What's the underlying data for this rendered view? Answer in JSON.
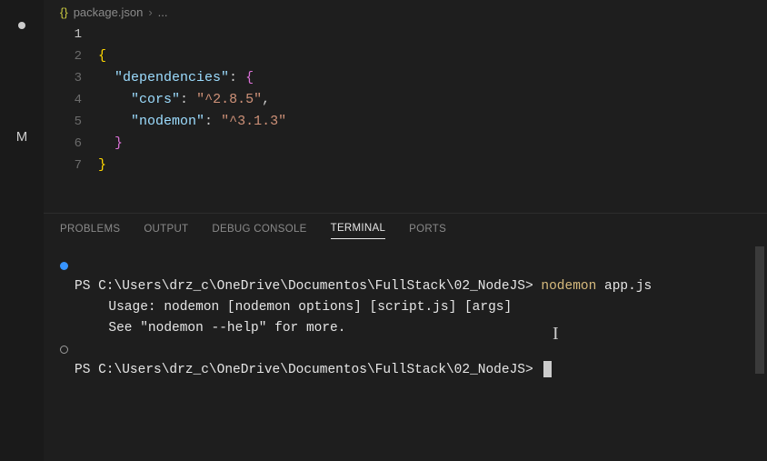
{
  "activity_bar": {
    "modified_indicator": "M"
  },
  "breadcrumb": {
    "file_icon": "{}",
    "file": "package.json",
    "sep": "›",
    "tail": "..."
  },
  "editor": {
    "line_numbers": [
      "1",
      "2",
      "3",
      "4",
      "5",
      "6",
      "7"
    ],
    "active_line_index": 0,
    "code": {
      "open_y": "{",
      "deps_key": "\"dependencies\"",
      "colon": ":",
      "open_p": "{",
      "cors_key": "\"cors\"",
      "cors_val": "\"^2.8.5\"",
      "comma": ",",
      "nodemon_key": "\"nodemon\"",
      "nodemon_val": "\"^3.1.3\"",
      "close_p": "}",
      "close_y": "}"
    }
  },
  "panel": {
    "tabs": {
      "problems": "PROBLEMS",
      "output": "OUTPUT",
      "debug": "DEBUG CONSOLE",
      "terminal": "TERMINAL",
      "ports": "PORTS"
    }
  },
  "terminal": {
    "prompt_prefix": "PS ",
    "path": "C:\\Users\\drz_c\\OneDrive\\Documentos\\FullStack\\02_NodeJS",
    "prompt_suffix": "> ",
    "cmd1_bin": "nodemon ",
    "cmd1_arg": "app.js",
    "usage_line": "  Usage: nodemon [nodemon options] [script.js] [args]",
    "blank": "",
    "help_line": "  See \"nodemon --help\" for more."
  }
}
